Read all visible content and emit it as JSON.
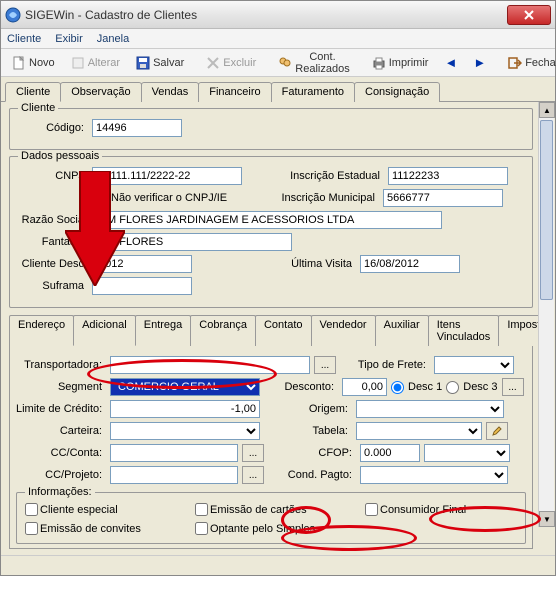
{
  "window": {
    "title": "SIGEWin - Cadastro de Clientes"
  },
  "menubar": {
    "cliente": "Cliente",
    "exibir": "Exibir",
    "janela": "Janela"
  },
  "toolbar": {
    "novo": "Novo",
    "alterar": "Alterar",
    "salvar": "Salvar",
    "excluir": "Excluir",
    "cont": "Cont. Realizados",
    "imprimir": "Imprimir",
    "fechar": "Fechar"
  },
  "main_tabs": {
    "cliente": "Cliente",
    "obs": "Observação",
    "vendas": "Vendas",
    "financeiro": "Financeiro",
    "faturamento": "Faturamento",
    "consignacao": "Consignação"
  },
  "cliente_group": {
    "legend": "Cliente",
    "codigo_label": "Código:",
    "codigo": "14496"
  },
  "dados": {
    "legend": "Dados pessoais",
    "cnpj_label": "CNPJ",
    "cnpj": "11.111.111/2222-22",
    "nao_verificar": "Não verificar o CNPJ/IE",
    "ie_label": "Inscrição Estadual",
    "ie": "11122233",
    "im_label": "Inscrição Municipal",
    "im": "5666777",
    "razao_label": "Razão Socia",
    "razao": "DIM FLORES JARDINAGEM E ACESSORIOS LTDA",
    "fantasia_label": "Fantasia",
    "fantasia": "DIM FLORES",
    "desde_label": "Cliente Desc",
    "desde": "/2012",
    "ultima_label": "Última Visita",
    "ultima": "16/08/2012",
    "suframa_label": "Suframa",
    "suframa": ""
  },
  "inner_tabs": {
    "endereco": "Endereço",
    "adicional": "Adicional",
    "entrega": "Entrega",
    "cobranca": "Cobrança",
    "contato": "Contato",
    "vendedor": "Vendedor",
    "auxiliar": "Auxiliar",
    "itens": "Itens Vinculados",
    "impostos": "Impost"
  },
  "adicional": {
    "transportadora_label": "Transportadora:",
    "transportadora": "",
    "tipo_frete_label": "Tipo de Frete:",
    "tipo_frete": "",
    "segmento_label": "Segment",
    "segmento": "COMERCIO GERAL",
    "desconto_label": "Desconto:",
    "desconto": "0,00",
    "desc1": "Desc 1",
    "desc3": "Desc 3",
    "limite_label": "Limite de Crédito:",
    "limite": "-1,00",
    "origem_label": "Origem:",
    "origem": "",
    "carteira_label": "Carteira:",
    "carteira": "",
    "tabela_label": "Tabela:",
    "tabela": "",
    "ccconta_label": "CC/Conta:",
    "ccconta": "",
    "cfop_label": "CFOP:",
    "cfop": "0.000",
    "ccprojeto_label": "CC/Projeto:",
    "ccprojeto": "",
    "condpagto_label": "Cond. Pagto:",
    "condpagto": ""
  },
  "info": {
    "legend": "Informações:",
    "especial": "Cliente especial",
    "cartoes": "Emissão de cartões",
    "consumidor": "Consumidor Final",
    "convites": "Emissão de convites",
    "simples": "Optante pelo Simples"
  },
  "colors": {
    "highlight_bg": "#1030b0",
    "highlight_fg": "#ffffff",
    "annotation": "#d9000d"
  }
}
